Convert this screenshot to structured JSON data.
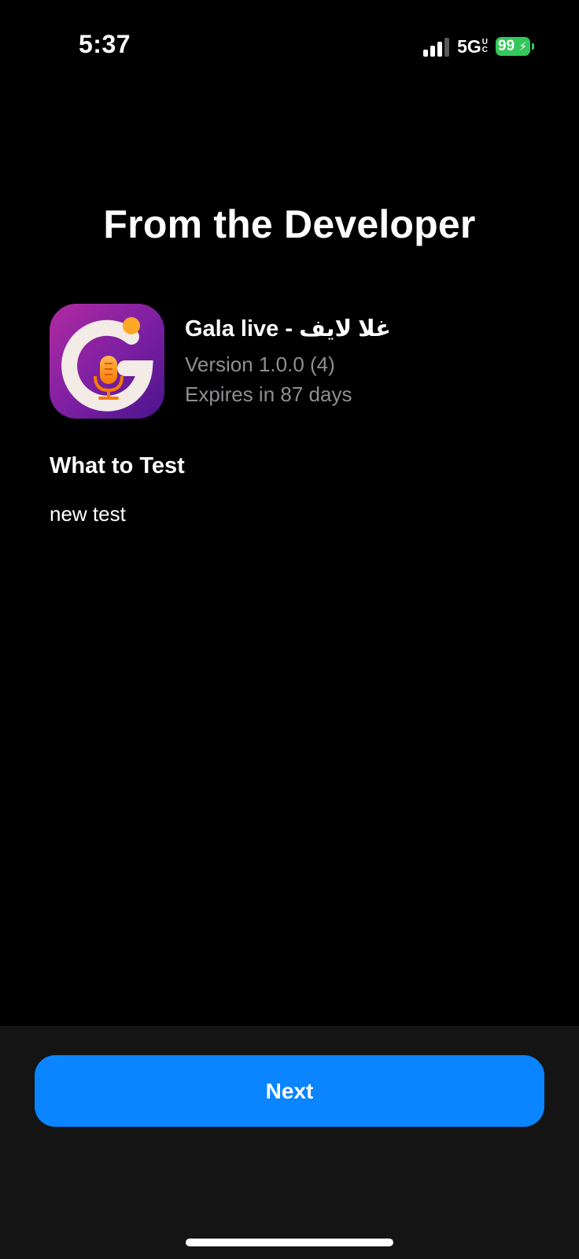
{
  "status_bar": {
    "time": "5:37",
    "network": "5G",
    "network_suffix_top": "U",
    "network_suffix_bottom": "C",
    "battery_level": "99",
    "battery_charging_glyph": "⚡",
    "battery_color": "#34c759",
    "signal_bars_active": 3,
    "signal_bars_total": 4
  },
  "title": "From the Developer",
  "app": {
    "name": "Gala live - غلا لايف",
    "version": "Version 1.0.0 (4)",
    "expiry": "Expires in 87 days",
    "icon": "gala-live-app-icon"
  },
  "what_to_test": {
    "heading": "What to Test",
    "body": "new test"
  },
  "footer": {
    "next_label": "Next",
    "accent_color": "#0a84ff"
  }
}
